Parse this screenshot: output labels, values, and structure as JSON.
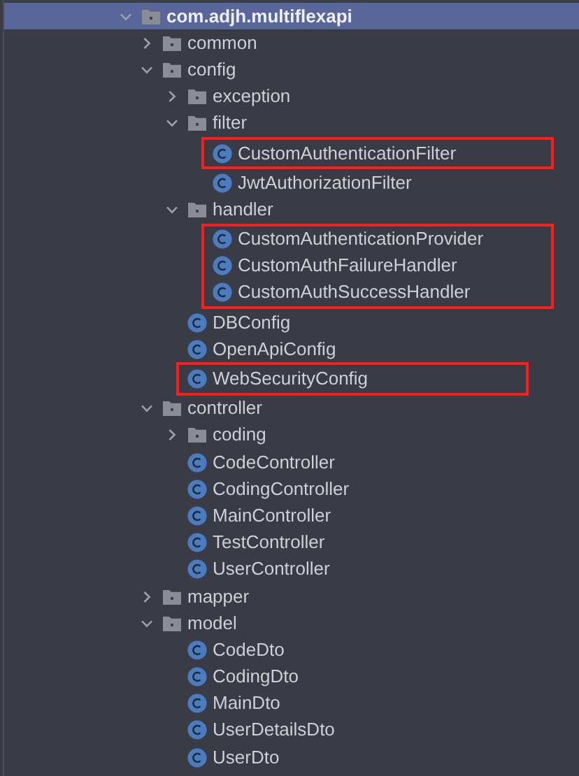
{
  "tree": [
    {
      "name": "com.adjh.multiflexapi",
      "kind": "folder",
      "expanded": true,
      "selected": true,
      "highlighted": false,
      "children": [
        {
          "name": "common",
          "kind": "folder",
          "expanded": false,
          "selected": false,
          "highlighted": false
        },
        {
          "name": "config",
          "kind": "folder",
          "expanded": true,
          "selected": false,
          "highlighted": false,
          "children": [
            {
              "name": "exception",
              "kind": "folder",
              "expanded": false,
              "selected": false,
              "highlighted": false
            },
            {
              "name": "filter",
              "kind": "folder",
              "expanded": true,
              "selected": false,
              "highlighted": false,
              "children": [
                {
                  "name": "CustomAuthenticationFilter",
                  "kind": "class",
                  "selected": false,
                  "highlighted": true
                },
                {
                  "name": "JwtAuthorizationFilter",
                  "kind": "class",
                  "selected": false,
                  "highlighted": false
                }
              ]
            },
            {
              "name": "handler",
              "kind": "folder",
              "expanded": true,
              "selected": false,
              "highlighted": false,
              "children": [
                {
                  "name": "CustomAuthenticationProvider",
                  "kind": "class",
                  "selected": false,
                  "highlighted": true
                },
                {
                  "name": "CustomAuthFailureHandler",
                  "kind": "class",
                  "selected": false,
                  "highlighted": true
                },
                {
                  "name": "CustomAuthSuccessHandler",
                  "kind": "class",
                  "selected": false,
                  "highlighted": true
                }
              ]
            },
            {
              "name": "DBConfig",
              "kind": "class",
              "selected": false,
              "highlighted": false
            },
            {
              "name": "OpenApiConfig",
              "kind": "class",
              "selected": false,
              "highlighted": false
            },
            {
              "name": "WebSecurityConfig",
              "kind": "class",
              "selected": false,
              "highlighted": true
            }
          ]
        },
        {
          "name": "controller",
          "kind": "folder",
          "expanded": true,
          "selected": false,
          "highlighted": false,
          "children": [
            {
              "name": "coding",
              "kind": "folder",
              "expanded": false,
              "selected": false,
              "highlighted": false
            },
            {
              "name": "CodeController",
              "kind": "class",
              "selected": false,
              "highlighted": false
            },
            {
              "name": "CodingController",
              "kind": "class",
              "selected": false,
              "highlighted": false
            },
            {
              "name": "MainController",
              "kind": "class",
              "selected": false,
              "highlighted": false
            },
            {
              "name": "TestController",
              "kind": "class",
              "selected": false,
              "highlighted": false
            },
            {
              "name": "UserController",
              "kind": "class",
              "selected": false,
              "highlighted": false
            }
          ]
        },
        {
          "name": "mapper",
          "kind": "folder",
          "expanded": false,
          "selected": false,
          "highlighted": false
        },
        {
          "name": "model",
          "kind": "folder",
          "expanded": true,
          "selected": false,
          "highlighted": false,
          "children": [
            {
              "name": "CodeDto",
              "kind": "class",
              "selected": false,
              "highlighted": false
            },
            {
              "name": "CodingDto",
              "kind": "class",
              "selected": false,
              "highlighted": false
            },
            {
              "name": "MainDto",
              "kind": "class",
              "selected": false,
              "highlighted": false
            },
            {
              "name": "UserDetailsDto",
              "kind": "class",
              "selected": false,
              "highlighted": false
            },
            {
              "name": "UserDto",
              "kind": "class",
              "selected": false,
              "highlighted": false
            }
          ]
        }
      ]
    }
  ]
}
